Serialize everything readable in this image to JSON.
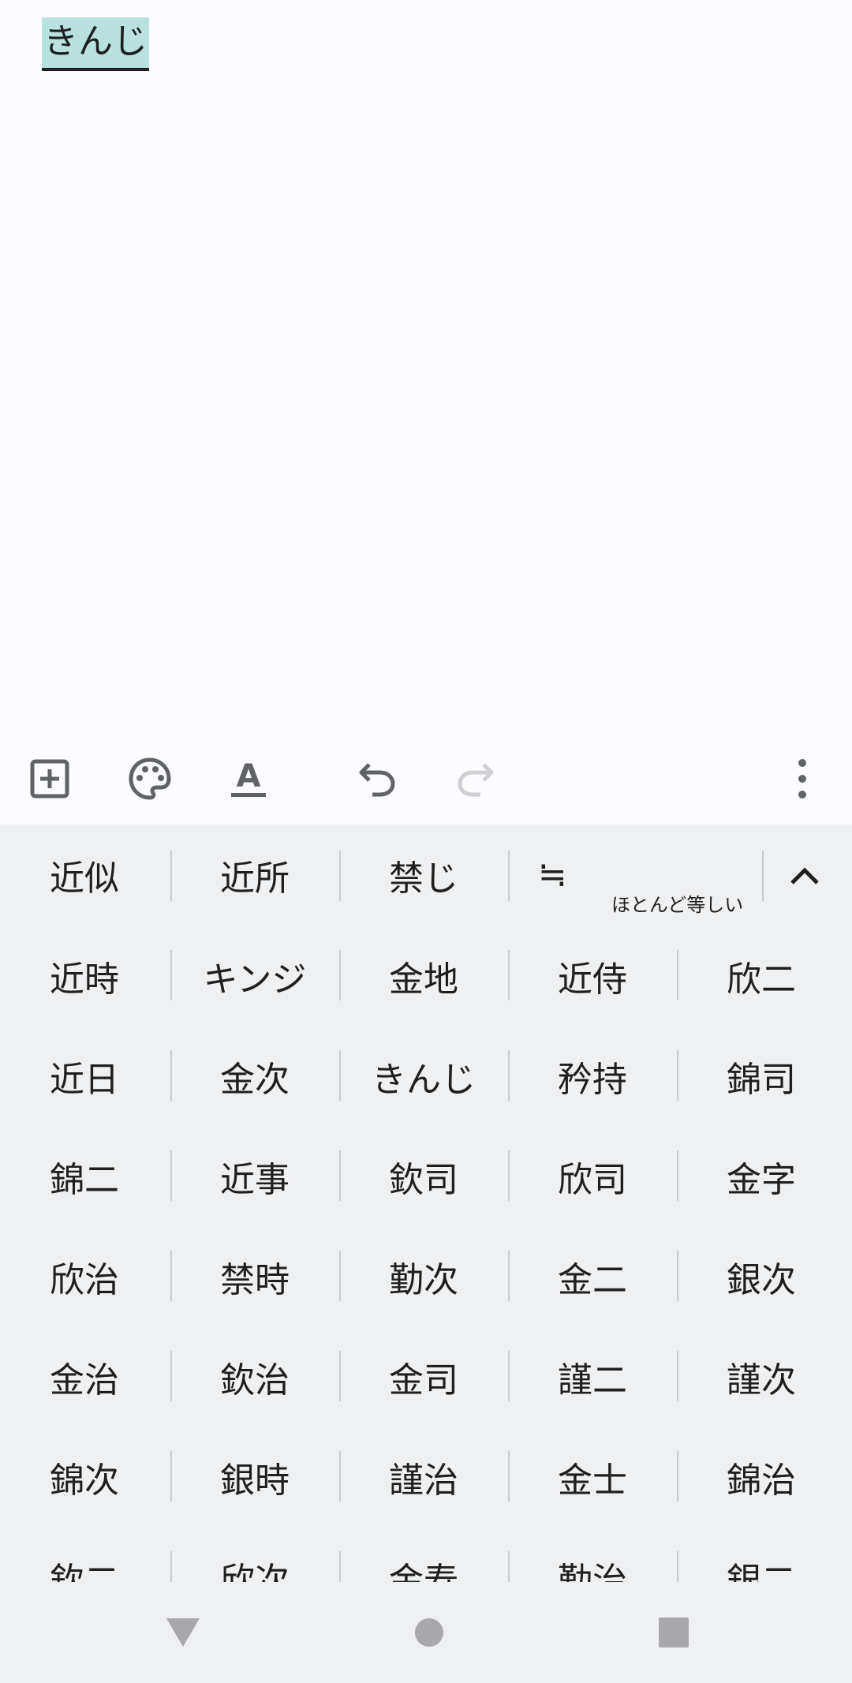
{
  "editor": {
    "composing_text": "きんじ"
  },
  "toolbar": {
    "icons": [
      "add-box-icon",
      "palette-icon",
      "text-format-icon",
      "undo-icon",
      "redo-icon",
      "more-vert-icon"
    ],
    "text_format_glyph": "A"
  },
  "keyboard": {
    "top_candidates": [
      "近似",
      "近所",
      "禁じ",
      "≒"
    ],
    "symbol_note": "ほとんど等しい",
    "rows": [
      [
        "近時",
        "キンジ",
        "金地",
        "近侍",
        "欣二"
      ],
      [
        "近日",
        "金次",
        "きんじ",
        "矜持",
        "錦司"
      ],
      [
        "錦二",
        "近事",
        "欽司",
        "欣司",
        "金字"
      ],
      [
        "欣治",
        "禁時",
        "勤次",
        "金二",
        "銀次"
      ],
      [
        "金治",
        "欽治",
        "金司",
        "謹二",
        "謹次"
      ],
      [
        "錦次",
        "銀時",
        "謹治",
        "金士",
        "錦治"
      ],
      [
        "欽二",
        "欣次",
        "金寿",
        "勤治",
        "銀二"
      ]
    ]
  },
  "colors": {
    "composing_highlight": "#b8e1df",
    "keyboard_bg": "#eff0f2",
    "icon": "#5f6368",
    "icon_disabled": "#d0d0d2"
  },
  "navbar": {
    "icons": [
      "back-triangle-icon",
      "home-circle-icon",
      "recents-square-icon"
    ]
  }
}
